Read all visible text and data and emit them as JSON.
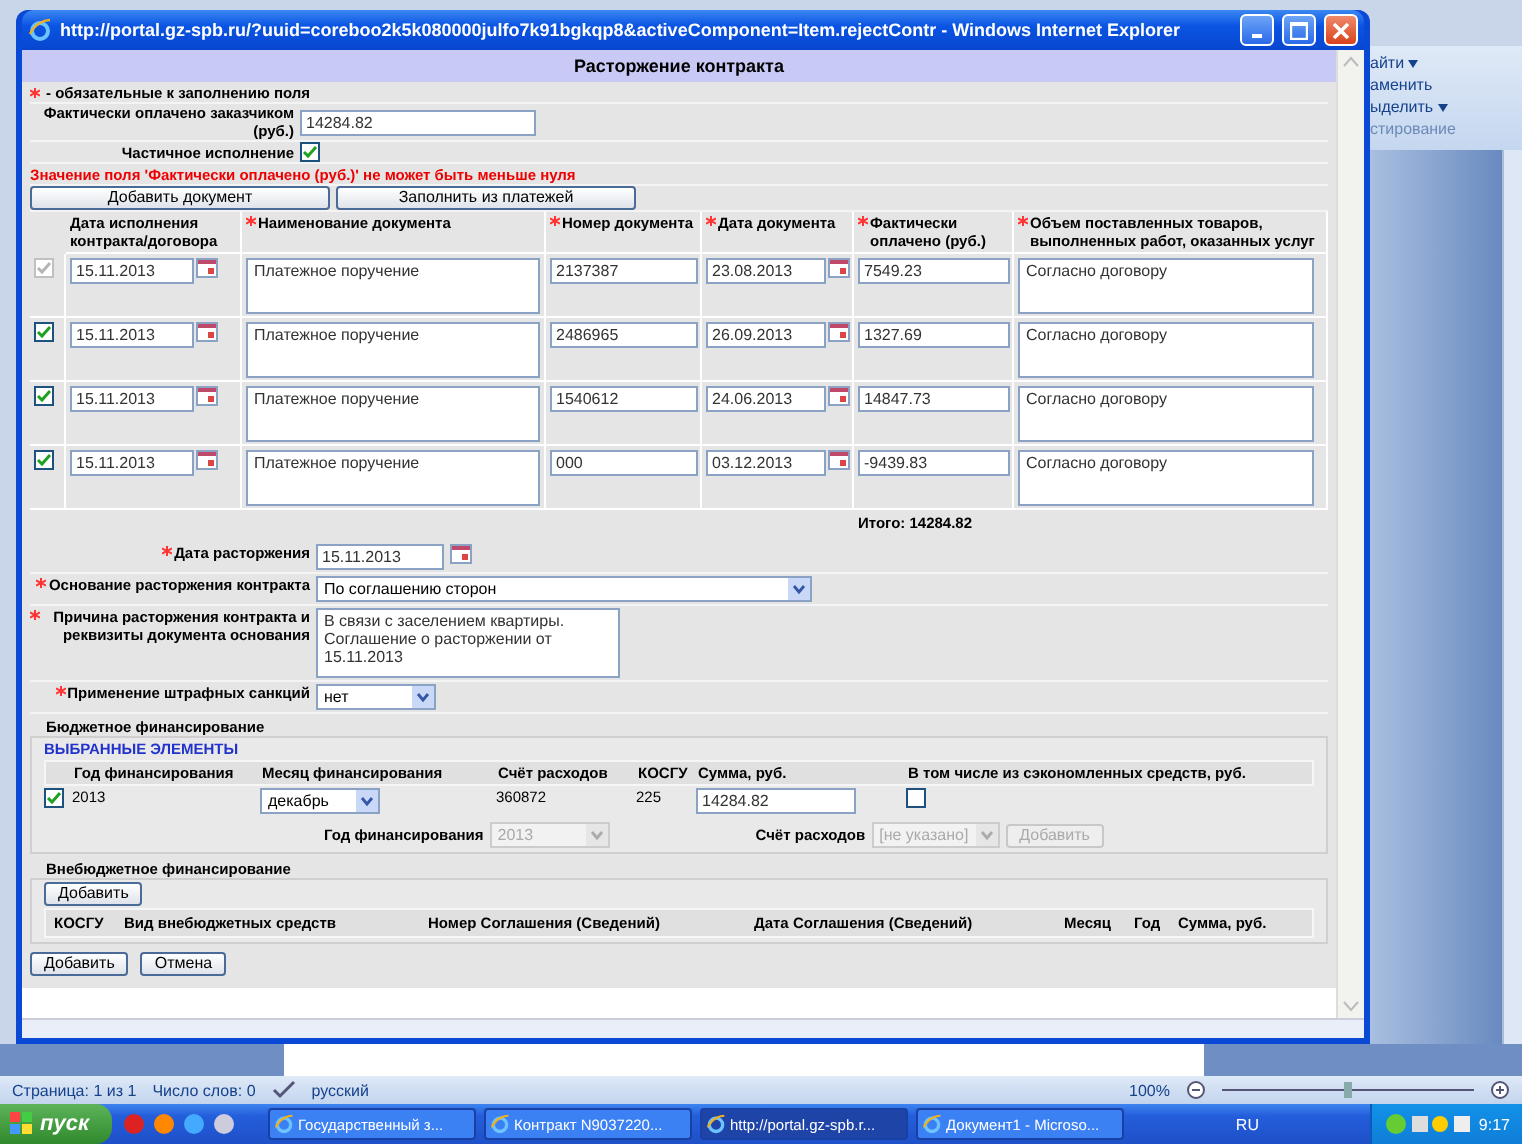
{
  "browser_window": {
    "title": "http://portal.gz-spb.ru/?uuid=coreboo2k5k080000julfo7k91bgkqp8&activeComponent=Item.rejectContr - Windows Internet Explorer"
  },
  "form": {
    "title": "Расторжение контракта",
    "legend": "- обязательные к заполнению поля",
    "paid_by_customer": {
      "label": "Фактически оплачено заказчиком (руб.)",
      "value": "14284.82"
    },
    "partial": {
      "label": "Частичное исполнение",
      "checked": true
    },
    "error": "Значение поля 'Фактически оплачено (руб.)' не может быть меньше нуля",
    "doc_buttons": [
      "Добавить документ",
      "Заполнить из платежей"
    ],
    "documents": {
      "columns": [
        {
          "label": "Дата исполнения контракта/договора",
          "required": false
        },
        {
          "label": "Наименование документа",
          "required": true
        },
        {
          "label": "Номер документа",
          "required": true
        },
        {
          "label": "Дата документа",
          "required": true
        },
        {
          "label": "Фактически оплачено (руб.)",
          "required": true
        },
        {
          "label": "Объем поставленных товаров, выполненных работ, оказанных услуг",
          "required": true
        }
      ],
      "rows": [
        {
          "checked": true,
          "disabled": true,
          "date": "15.11.2013",
          "name": "Платежное поручение",
          "number": "2137387",
          "doc_date": "23.08.2013",
          "paid": "7549.23",
          "volume": "Согласно договору"
        },
        {
          "checked": true,
          "disabled": false,
          "date": "15.11.2013",
          "name": "Платежное поручение",
          "number": "2486965",
          "doc_date": "26.09.2013",
          "paid": "1327.69",
          "volume": "Согласно договору"
        },
        {
          "checked": true,
          "disabled": false,
          "date": "15.11.2013",
          "name": "Платежное поручение",
          "number": "1540612",
          "doc_date": "24.06.2013",
          "paid": "14847.73",
          "volume": "Согласно договору"
        },
        {
          "checked": true,
          "disabled": false,
          "date": "15.11.2013",
          "name": "Платежное поручение",
          "number": "000",
          "doc_date": "03.12.2013",
          "paid": "-9439.83",
          "volume": "Согласно договору"
        }
      ],
      "total": "Итого: 14284.82"
    },
    "fields": [
      {
        "kind": "date",
        "label": "Дата расторжения",
        "required": true,
        "value": "15.11.2013"
      },
      {
        "kind": "select",
        "label": "Основание расторжения контракта",
        "required": true,
        "value": "По соглашению сторон"
      },
      {
        "kind": "textarea",
        "label": "Причина расторжения контракта и реквизиты документа основания",
        "required": true,
        "value": "В связи с заселением квартиры.\nСоглашение о расторжении от 15.11.2013"
      },
      {
        "kind": "short_select",
        "label": "Применение штрафных санкций",
        "required": true,
        "value": "нет"
      }
    ],
    "budget": {
      "title": "Бюджетное финансирование",
      "subtitle": "ВЫБРАННЫЕ ЭЛЕМЕНТЫ",
      "columns": [
        "Год финансирования",
        "Месяц финансирования",
        "Счёт расходов",
        "КОСГУ",
        "Сумма, руб.",
        "В том числе из сэкономленных средств, руб."
      ],
      "row": {
        "checked": true,
        "year": "2013",
        "month": "декабрь",
        "account": "360872",
        "kosgu": "225",
        "sum": "14284.82",
        "from_savings": false
      },
      "year_label": "Год финансирования",
      "year_value": "2013",
      "account_label": "Счёт расходов",
      "account_value": "[не указано]",
      "add_button": "Добавить"
    },
    "extra": {
      "title": "Внебюджетное финансирование",
      "add_button": "Добавить",
      "columns": [
        "КОСГУ",
        "Вид внебюджетных средств",
        "Номер Соглашения (Сведений)",
        "Дата Соглашения (Сведений)",
        "Месяц",
        "Год",
        "Сумма, руб."
      ]
    },
    "actions": [
      "Добавить",
      "Отмена"
    ]
  },
  "word_ribbon": {
    "items": [
      {
        "label": "айти",
        "dropdown": true
      },
      {
        "label": "аменить",
        "dropdown": false
      },
      {
        "label": "ыделить",
        "dropdown": true
      }
    ],
    "group": "стирование"
  },
  "status_bar": {
    "page": "Страница: 1 из 1",
    "words": "Число слов: 0",
    "language": "русский",
    "zoom": "100%",
    "zoom_slider": {
      "level": 0.5
    }
  },
  "taskbar": {
    "start": "пуск",
    "tasks": [
      {
        "label": "Государственный з...",
        "selected": false
      },
      {
        "label": "Контракт N9037220...",
        "selected": false
      },
      {
        "label": "http://portal.gz-spb.r...",
        "selected": true
      },
      {
        "label": "Документ1 - Microso...",
        "selected": false
      }
    ],
    "language": "RU",
    "clock": "9:17"
  }
}
